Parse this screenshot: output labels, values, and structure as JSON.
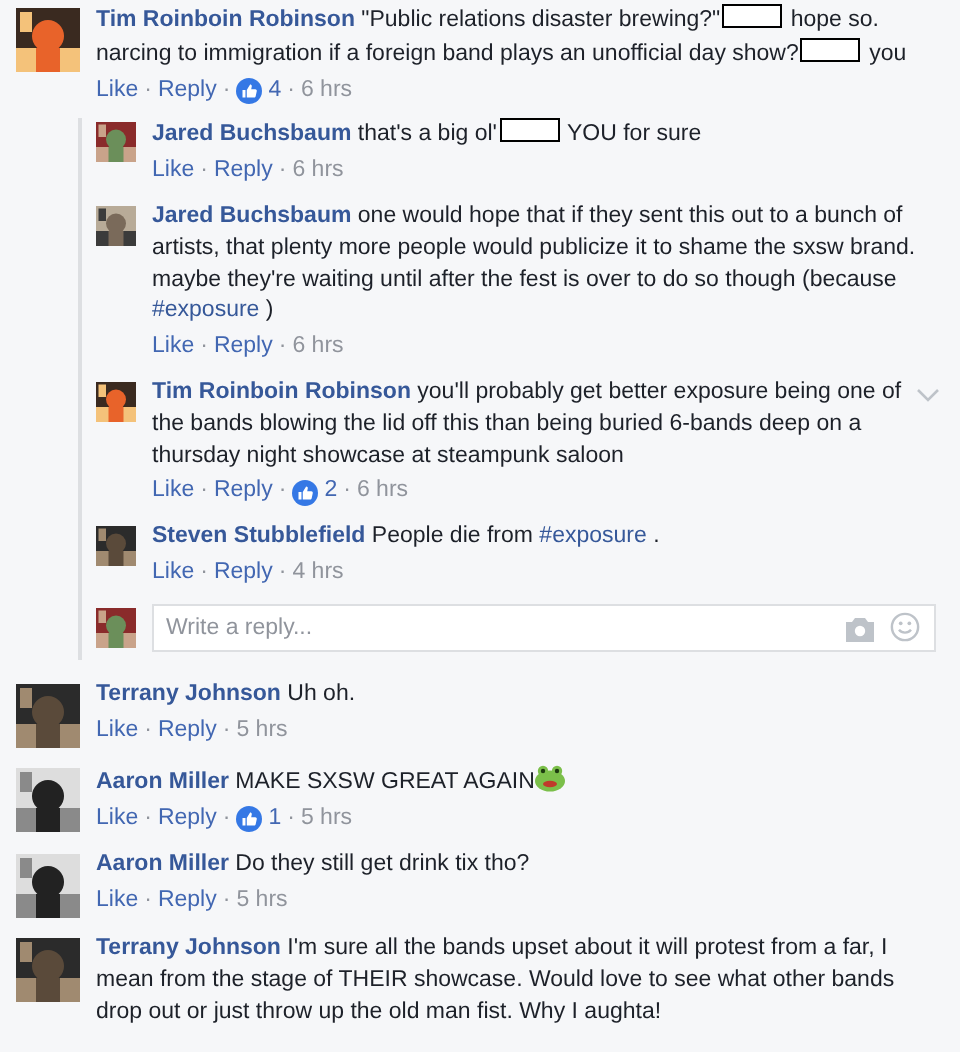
{
  "separator": "·",
  "comments": [
    {
      "author": "Tim Roinboin Robinson",
      "body": [
        {
          "kind": "text",
          "text": "\"Public relations disaster brewing?\""
        },
        {
          "kind": "redaction"
        },
        {
          "kind": "text",
          "text": "hope so. narcing to immigration if a foreign band plays an unofficial day show?"
        },
        {
          "kind": "redaction"
        },
        {
          "kind": "text",
          "text": "you"
        }
      ],
      "actions": [
        "Like",
        "Reply"
      ],
      "likes": "4",
      "time": "6 hrs",
      "replies": [
        {
          "author": "Jared Buchsbaum",
          "body": [
            {
              "kind": "text",
              "text": "that's a big ol'"
            },
            {
              "kind": "redaction"
            },
            {
              "kind": "text",
              "text": "YOU for sure"
            }
          ],
          "actions": [
            "Like",
            "Reply"
          ],
          "time": "6 hrs",
          "menu": false
        },
        {
          "author": "Jared Buchsbaum",
          "body": [
            {
              "kind": "text",
              "text": "one would hope that if they sent this out to a bunch of artists, that plenty more people would publicize it to shame the sxsw brand. maybe they're waiting until after the fest is over to do so though (because"
            },
            {
              "kind": "hashtag",
              "text": "#exposure"
            },
            {
              "kind": "text",
              "text": ")"
            }
          ],
          "actions": [
            "Like",
            "Reply"
          ],
          "time": "6 hrs",
          "menu": false
        },
        {
          "author": "Tim Roinboin Robinson",
          "body": [
            {
              "kind": "text",
              "text": "you'll probably get better exposure being one of the bands blowing the lid off this than being buried 6-bands deep on a thursday night showcase at steampunk saloon"
            }
          ],
          "actions": [
            "Like",
            "Reply"
          ],
          "likes": "2",
          "time": "6 hrs",
          "menu": true
        },
        {
          "author": "Steven Stubblefield",
          "body": [
            {
              "kind": "text",
              "text": "People die from"
            },
            {
              "kind": "hashtag",
              "text": "#exposure"
            },
            {
              "kind": "text",
              "text": "."
            }
          ],
          "actions": [
            "Like",
            "Reply"
          ],
          "time": "4 hrs",
          "menu": false
        }
      ],
      "reply_box": {
        "placeholder": "Write a reply..."
      }
    },
    {
      "author": "Terrany Johnson",
      "body": [
        {
          "kind": "text",
          "text": "Uh oh."
        }
      ],
      "actions": [
        "Like",
        "Reply"
      ],
      "time": "5 hrs"
    },
    {
      "author": "Aaron Miller",
      "body": [
        {
          "kind": "text",
          "text": "MAKE SXSW GREAT AGAIN"
        },
        {
          "kind": "emoji"
        }
      ],
      "actions": [
        "Like",
        "Reply"
      ],
      "likes": "1",
      "time": "5 hrs"
    },
    {
      "author": "Aaron Miller",
      "body": [
        {
          "kind": "text",
          "text": "Do they still get drink tix tho?"
        }
      ],
      "actions": [
        "Like",
        "Reply"
      ],
      "time": "5 hrs"
    },
    {
      "author": "Terrany Johnson",
      "body": [
        {
          "kind": "text",
          "text": "I'm sure all the bands upset about it will protest from a far, I mean from the stage of THEIR showcase. Would love to see what other bands drop out or just throw up the old man fist. Why I aughta!"
        }
      ]
    }
  ]
}
